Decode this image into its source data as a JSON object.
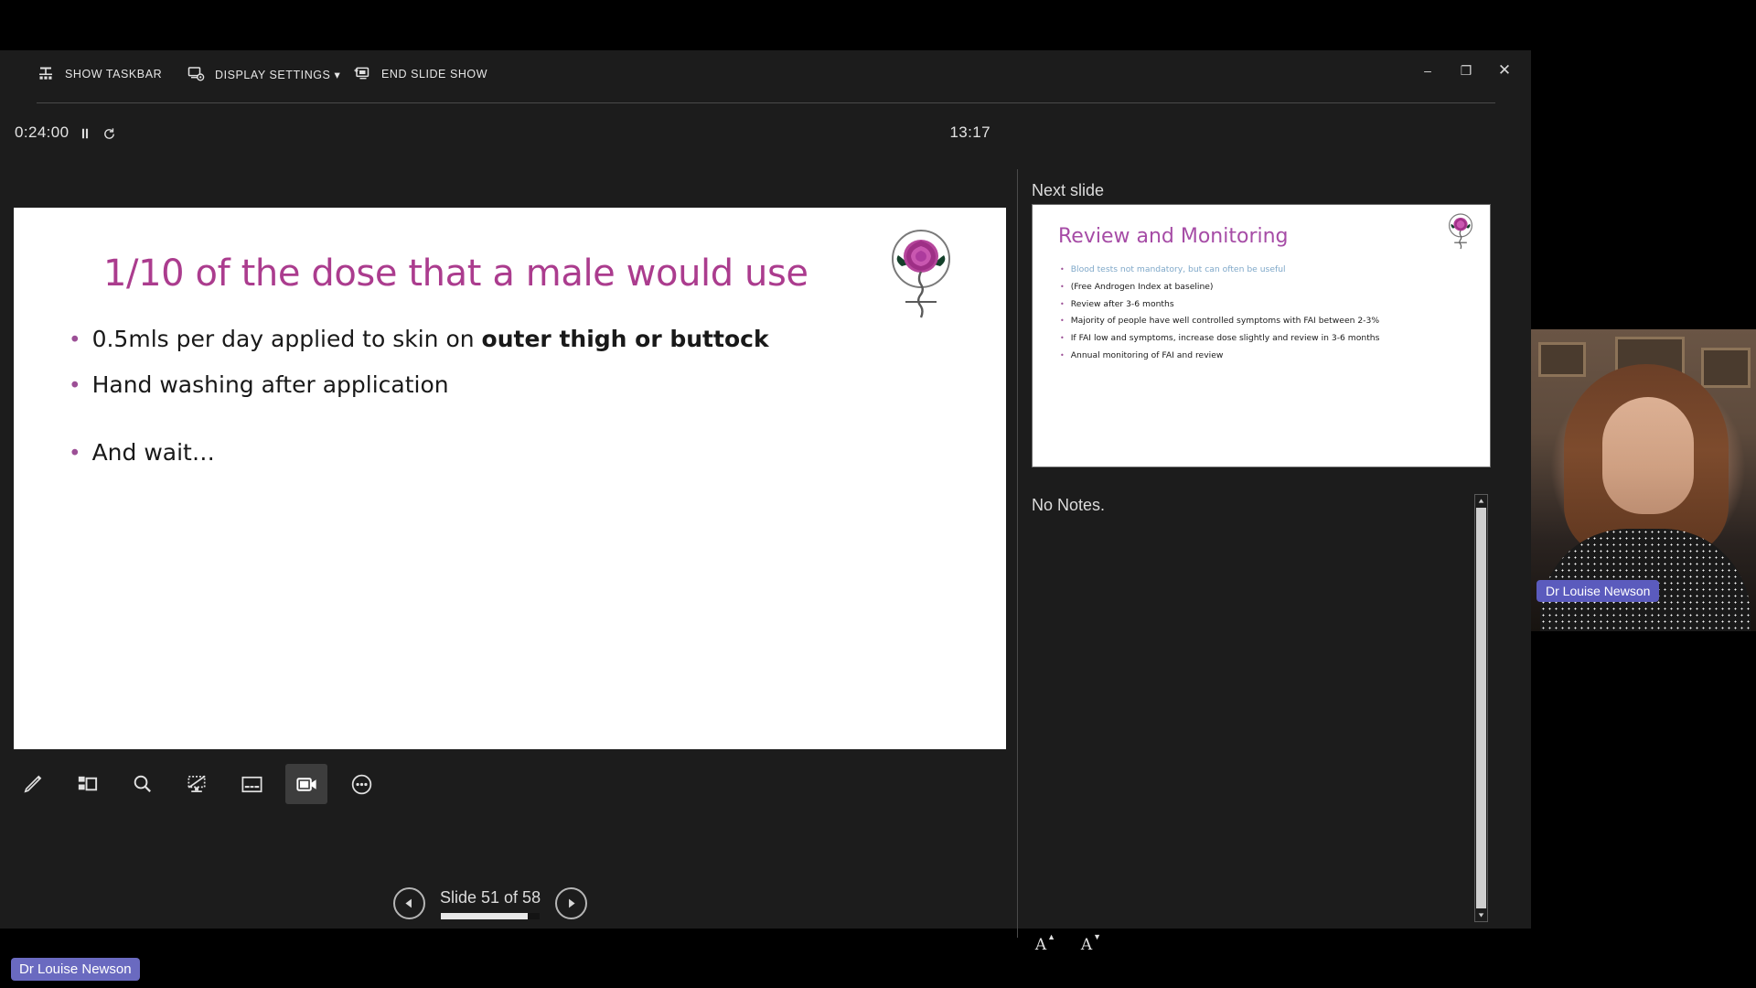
{
  "toolbar": {
    "show_taskbar": "SHOW TASKBAR",
    "display_settings": "DISPLAY SETTINGS ▾",
    "end_slide_show": "END SLIDE SHOW"
  },
  "window_controls": {
    "minimize": "–",
    "restore": "❐",
    "close": "✕"
  },
  "timer": {
    "elapsed": "0:24:00",
    "clock": "13:17"
  },
  "slide": {
    "title": "1/10 of the dose that a male would use",
    "bullets": [
      {
        "pre": "0.5mls per day applied to skin on ",
        "bold": "outer thigh or buttock"
      },
      {
        "pre": "Hand washing after application",
        "bold": ""
      },
      {
        "pre": "And wait…",
        "bold": ""
      }
    ]
  },
  "next_pane": {
    "label": "Next slide",
    "title": "Review and Monitoring",
    "bullets": [
      "Blood tests not mandatory, but can often be useful",
      "(Free Androgen Index at baseline)",
      "Review after 3-6 months",
      "Majority of people have well controlled symptoms with FAI between 2-3%",
      "If FAI low and symptoms, increase dose slightly and review in 3-6 months",
      "Annual monitoring of FAI and review"
    ]
  },
  "notes": {
    "text": "No Notes.",
    "font_larger": "A",
    "font_smaller": "A"
  },
  "navigation": {
    "slide_text": "Slide 51 of 58",
    "current": 51,
    "total": 58,
    "progress_percent": 88
  },
  "tools": [
    "pen-tool",
    "all-slides-tool",
    "zoom-tool",
    "black-screen-tool",
    "subtitles-tool",
    "camera-tool",
    "more-options-tool"
  ],
  "participant": {
    "name": "Dr Louise Newson"
  },
  "colors": {
    "accent_magenta": "#ab3c8e",
    "next_title_purple": "#a64ca6",
    "bullet_purple": "#9c4f96",
    "teal_bullet": "#7fa8c9",
    "name_badge": "#5b5bbd",
    "chrome_bg": "#1c1c1c"
  }
}
